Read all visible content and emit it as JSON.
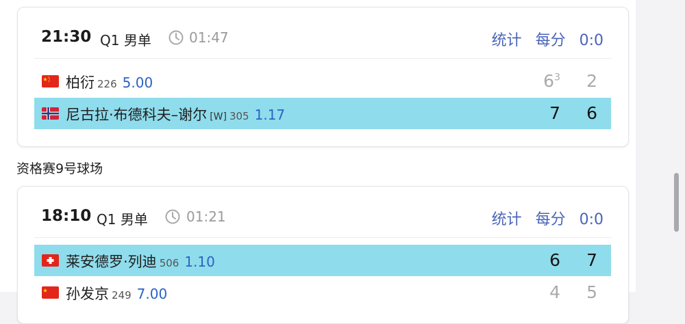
{
  "matches": [
    {
      "time": "21:30",
      "round": "Q1 男单",
      "elapsed": "01:47",
      "links": {
        "stats": "统计",
        "per_point": "每分",
        "score": "0:0"
      },
      "players": [
        {
          "flag": "china",
          "name": "柏衍",
          "tag": "",
          "rank": "226",
          "odds": "5.00",
          "set1": "6",
          "set1_tb": "3",
          "set2": "2",
          "winner": false
        },
        {
          "flag": "norway",
          "name": "尼古拉·布德科夫–谢尔",
          "tag": "[W]",
          "rank": "305",
          "odds": "1.17",
          "set1": "7",
          "set1_tb": "",
          "set2": "6",
          "winner": true
        }
      ]
    },
    {
      "time": "18:10",
      "round": "Q1 男单",
      "elapsed": "01:21",
      "links": {
        "stats": "统计",
        "per_point": "每分",
        "score": "0:0"
      },
      "players": [
        {
          "flag": "switzerland",
          "name": "莱安德罗·列迪",
          "tag": "",
          "rank": "506",
          "odds": "1.10",
          "set1": "6",
          "set1_tb": "",
          "set2": "7",
          "winner": true
        },
        {
          "flag": "china",
          "name": "孙发京",
          "tag": "",
          "rank": "249",
          "odds": "7.00",
          "set1": "4",
          "set1_tb": "",
          "set2": "5",
          "winner": false
        }
      ]
    }
  ],
  "section_title": "资格赛9号球场",
  "colors": {
    "link": "#4a64b8",
    "odds": "#2b63c4",
    "highlight": "#8fdcec"
  }
}
